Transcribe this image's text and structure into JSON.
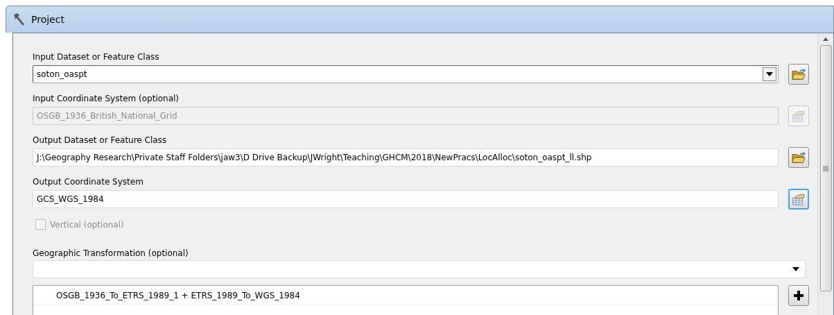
{
  "window": {
    "title": "Project"
  },
  "parameters": [
    {
      "kind": "dropdown",
      "label": "Input Dataset or Feature Class",
      "value": "soton_oaspt",
      "disabled": false,
      "button": {
        "kind": "folder"
      }
    },
    {
      "kind": "text",
      "label": "Input Coordinate System (optional)",
      "value": "OSGB_1936_British_National_Grid",
      "disabled": true,
      "button": {
        "kind": "crs"
      }
    },
    {
      "kind": "text",
      "label": "Output Dataset or Feature Class",
      "value": "J:\\Geography Research\\Private Staff Folders\\jaw3\\D Drive Backup\\JWright\\Teaching\\GHCM\\2018\\NewPracs\\LocAlloc\\soton_oaspt_ll.shp",
      "disabled": false,
      "button": {
        "kind": "folder"
      }
    },
    {
      "kind": "text",
      "label": "Output Coordinate System",
      "value": "GCS_WGS_1984",
      "disabled": false,
      "button": {
        "kind": "crs"
      },
      "focused": true
    },
    {
      "kind": "checkbox",
      "label": "Vertical (optional)",
      "checked": false,
      "disabled": true
    },
    {
      "kind": "combo",
      "label": "Geographic Transformation (optional)"
    },
    {
      "kind": "list",
      "items": [
        "OSGB_1936_To_ETRS_1989_1 + ETRS_1989_To_WGS_1984"
      ],
      "button": {
        "kind": "add"
      }
    }
  ]
}
